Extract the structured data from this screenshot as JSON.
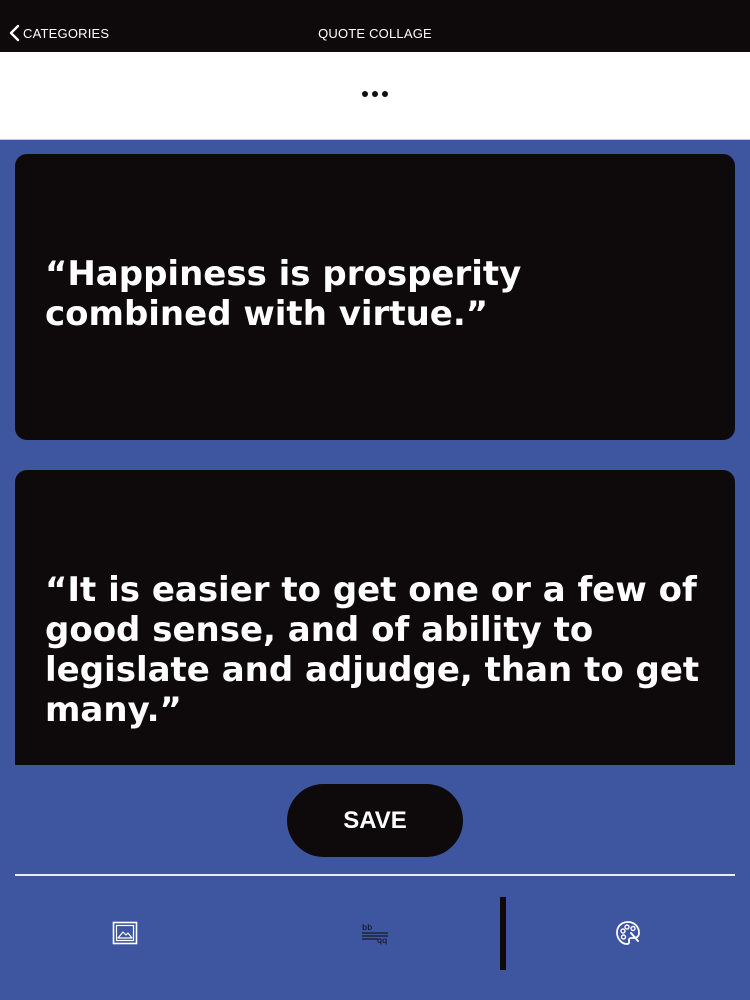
{
  "nav": {
    "back_label": "CATEGORIES",
    "title": "QUOTE COLLAGE"
  },
  "menu": {
    "more_icon": "ellipsis-icon"
  },
  "quotes": [
    {
      "text": "“Happiness is prosperity combined with virtue.”"
    },
    {
      "text": "“It is easier to get one or a few of good sense, and of ability to legislate and adjudge, than to get many.”"
    }
  ],
  "actions": {
    "save_label": "SAVE"
  },
  "toolbar": {
    "items": [
      {
        "icon": "image-icon"
      },
      {
        "icon": "text-format-icon"
      },
      {
        "icon": "palette-icon"
      }
    ]
  },
  "colors": {
    "background": "#3e559f",
    "card": "#0e0a0b",
    "text": "#ffffff",
    "topbar": "#0e0a0b"
  }
}
